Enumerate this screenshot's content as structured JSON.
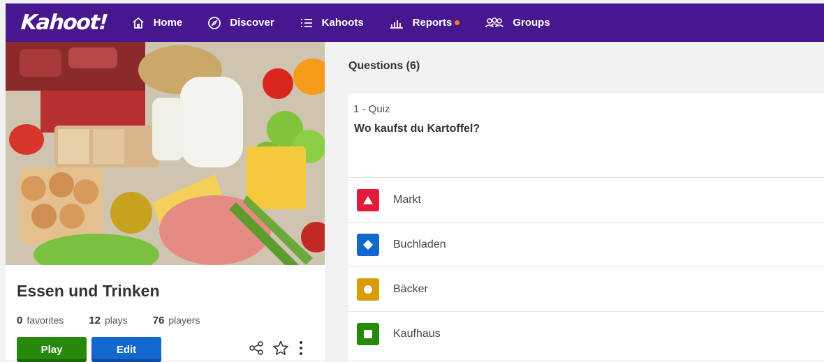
{
  "brand": {
    "logo": "Kahoot!",
    "color": "#46178f"
  },
  "nav": [
    {
      "label": "Home",
      "icon": "home-icon"
    },
    {
      "label": "Discover",
      "icon": "compass-icon"
    },
    {
      "label": "Kahoots",
      "icon": "list-icon"
    },
    {
      "label": "Reports",
      "icon": "bar-chart-icon",
      "notification": true
    },
    {
      "label": "Groups",
      "icon": "people-icon"
    }
  ],
  "kahoot": {
    "title": "Essen und Trinken",
    "stats": [
      {
        "value": "0",
        "label": "favorites"
      },
      {
        "value": "12",
        "label": "plays"
      },
      {
        "value": "76",
        "label": "players"
      }
    ],
    "play_label": "Play",
    "edit_label": "Edit"
  },
  "questions": {
    "header": "Questions (6)",
    "current": {
      "type": "1 - Quiz",
      "text": "Wo kaufst du Kartoffel?",
      "answers": [
        {
          "text": "Markt",
          "shape": "triangle-icon",
          "color": "#e21b3c"
        },
        {
          "text": "Buchladen",
          "shape": "diamond-icon",
          "color": "#1368ce"
        },
        {
          "text": "Bäcker",
          "shape": "circle-icon",
          "color": "#d89e00"
        },
        {
          "text": "Kaufhaus",
          "shape": "square-icon",
          "color": "#26890c"
        }
      ]
    }
  }
}
